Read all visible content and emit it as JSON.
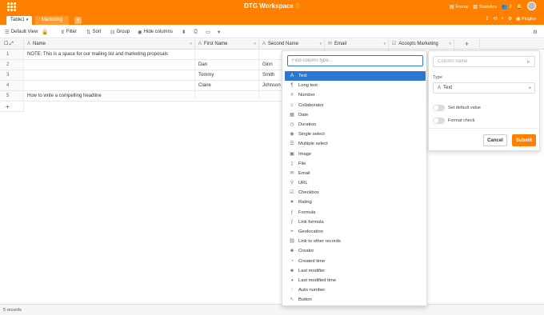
{
  "topbar": {
    "title": "DTG Workspace",
    "title_icon": "info-icon",
    "forms_label": "Forms",
    "statistics_label": "Statistics",
    "collaborators_count": "2"
  },
  "tabs": [
    {
      "label": "Table1",
      "active": true
    },
    {
      "label": "Marketing",
      "active": false
    }
  ],
  "tab_actions": {
    "plugins_label": "Plugins"
  },
  "toolbar": {
    "view_label": "Default View",
    "filter_label": "Filter",
    "sort_label": "Sort",
    "group_label": "Group",
    "hide_columns_label": "Hide columns"
  },
  "table": {
    "columns": [
      {
        "name": "Name",
        "icon": "text-icon"
      },
      {
        "name": "First Name",
        "icon": "text-icon"
      },
      {
        "name": "Second Name",
        "icon": "text-icon"
      },
      {
        "name": "Email",
        "icon": "email-icon"
      },
      {
        "name": "Accepts Marketing",
        "icon": "checkbox-icon"
      }
    ],
    "rows": [
      {
        "num": "1",
        "cells": [
          "NOTE: This is a space for our mailing list and marketing proposals",
          "",
          "",
          "",
          ""
        ]
      },
      {
        "num": "2",
        "cells": [
          "",
          "Dan",
          "Ginn",
          "",
          ""
        ]
      },
      {
        "num": "3",
        "cells": [
          "",
          "Tommy",
          "Smith",
          "",
          ""
        ]
      },
      {
        "num": "4",
        "cells": [
          "",
          "Claire",
          "Johnson",
          "",
          ""
        ]
      },
      {
        "num": "5",
        "cells": [
          "How to write a compelling headline",
          "",
          "",
          "",
          ""
        ]
      }
    ],
    "add_row_label": "+"
  },
  "footer": {
    "records_label": "5 records"
  },
  "column_type_menu": {
    "search_placeholder": "Find column type...",
    "items": [
      {
        "label": "Text",
        "icon": "text-icon",
        "selected": true
      },
      {
        "label": "Long text",
        "icon": "long-text-icon"
      },
      {
        "label": "Number",
        "icon": "number-icon"
      },
      {
        "label": "Collaborator",
        "icon": "collaborator-icon"
      },
      {
        "label": "Date",
        "icon": "date-icon"
      },
      {
        "label": "Duration",
        "icon": "duration-icon"
      },
      {
        "label": "Single select",
        "icon": "single-select-icon"
      },
      {
        "label": "Multiple select",
        "icon": "multiple-select-icon"
      },
      {
        "label": "Image",
        "icon": "image-icon"
      },
      {
        "label": "File",
        "icon": "file-icon"
      },
      {
        "label": "Email",
        "icon": "email-icon"
      },
      {
        "label": "URL",
        "icon": "url-icon"
      },
      {
        "label": "Checkbox",
        "icon": "checkbox-icon"
      },
      {
        "label": "Rating",
        "icon": "rating-icon"
      },
      {
        "label": "Formula",
        "icon": "formula-icon"
      },
      {
        "label": "Link formula",
        "icon": "link-formula-icon"
      },
      {
        "label": "Geolocation",
        "icon": "geolocation-icon"
      },
      {
        "label": "Link to other records",
        "icon": "link-icon"
      },
      {
        "label": "Creator",
        "icon": "creator-icon"
      },
      {
        "label": "Created time",
        "icon": "created-time-icon"
      },
      {
        "label": "Last modifier",
        "icon": "last-modifier-icon"
      },
      {
        "label": "Last modified time",
        "icon": "last-modified-time-icon"
      },
      {
        "label": "Auto number",
        "icon": "auto-number-icon"
      },
      {
        "label": "Button",
        "icon": "button-icon"
      }
    ]
  },
  "column_panel": {
    "name_placeholder": "Column name",
    "type_label": "Type",
    "type_value": "Text",
    "default_value_label": "Set default value",
    "format_check_label": "Format check",
    "cancel_label": "Cancel",
    "submit_label": "Submit"
  },
  "colors": {
    "brand": "#ff8000",
    "accent": "#2d76d2"
  }
}
